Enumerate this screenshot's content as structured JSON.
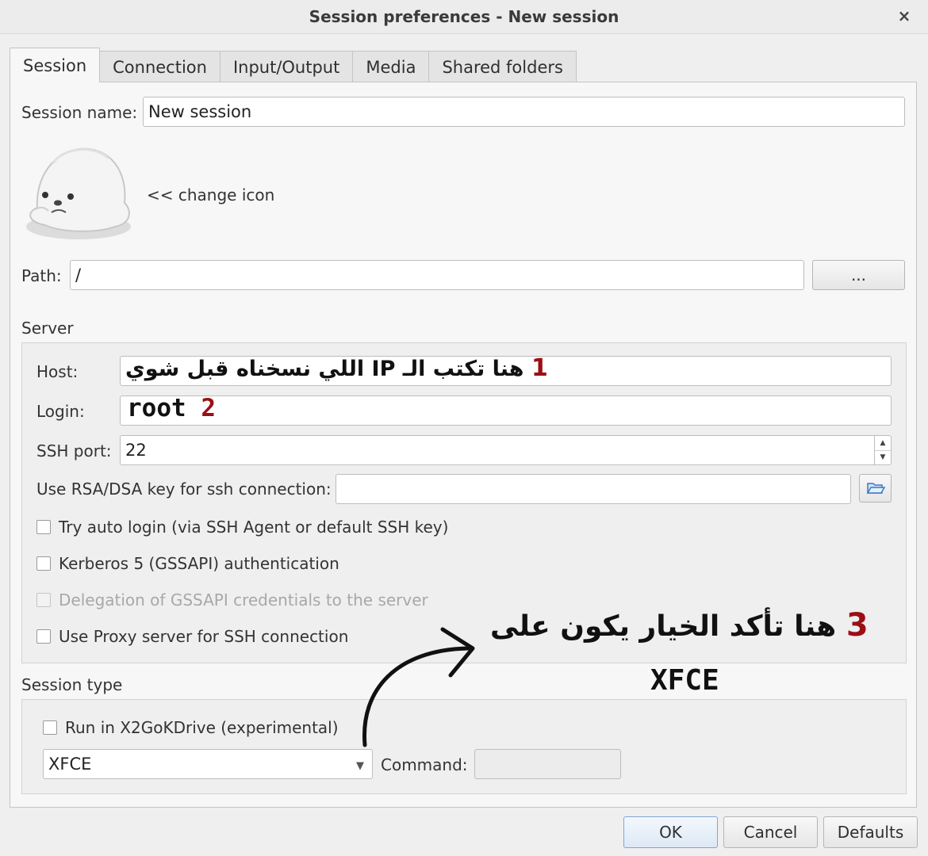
{
  "window": {
    "title": "Session preferences - New session",
    "close_glyph": "×"
  },
  "tabs": [
    {
      "label": "Session",
      "active": true
    },
    {
      "label": "Connection",
      "active": false
    },
    {
      "label": "Input/Output",
      "active": false
    },
    {
      "label": "Media",
      "active": false
    },
    {
      "label": "Shared folders",
      "active": false
    }
  ],
  "session": {
    "name_label": "Session name:",
    "name_value": "New session",
    "change_icon": "<< change icon",
    "path_label": "Path:",
    "path_value": "/",
    "browse_label": "..."
  },
  "server": {
    "group_label": "Server",
    "host_label": "Host:",
    "host_value": "",
    "login_label": "Login:",
    "login_value": "",
    "ssh_port_label": "SSH port:",
    "ssh_port_value": "22",
    "rsa_label": "Use RSA/DSA key for ssh connection:",
    "rsa_value": "",
    "checkboxes": [
      {
        "label": "Try auto login (via SSH Agent or default SSH key)",
        "checked": false,
        "disabled": false
      },
      {
        "label": "Kerberos 5 (GSSAPI) authentication",
        "checked": false,
        "disabled": false
      },
      {
        "label": "Delegation of GSSAPI credentials to the server",
        "checked": false,
        "disabled": true
      },
      {
        "label": "Use Proxy server for SSH connection",
        "checked": false,
        "disabled": false
      }
    ]
  },
  "session_type": {
    "group_label": "Session type",
    "kdrive_label": "Run in X2GoKDrive (experimental)",
    "type_value": "XFCE",
    "command_label": "Command:",
    "command_value": ""
  },
  "buttons": {
    "ok": "OK",
    "cancel": "Cancel",
    "defaults": "Defaults"
  },
  "annotations": {
    "host_text": "هنا تكتب الـ IP اللي نسخناه قبل شوي",
    "host_num": "1",
    "login_text": "root",
    "login_num": "2",
    "type_text": "هنا تأكد الخيار يكون على",
    "type_num": "3",
    "type_value": "XFCE",
    "accent_color": "#9b0f14"
  }
}
